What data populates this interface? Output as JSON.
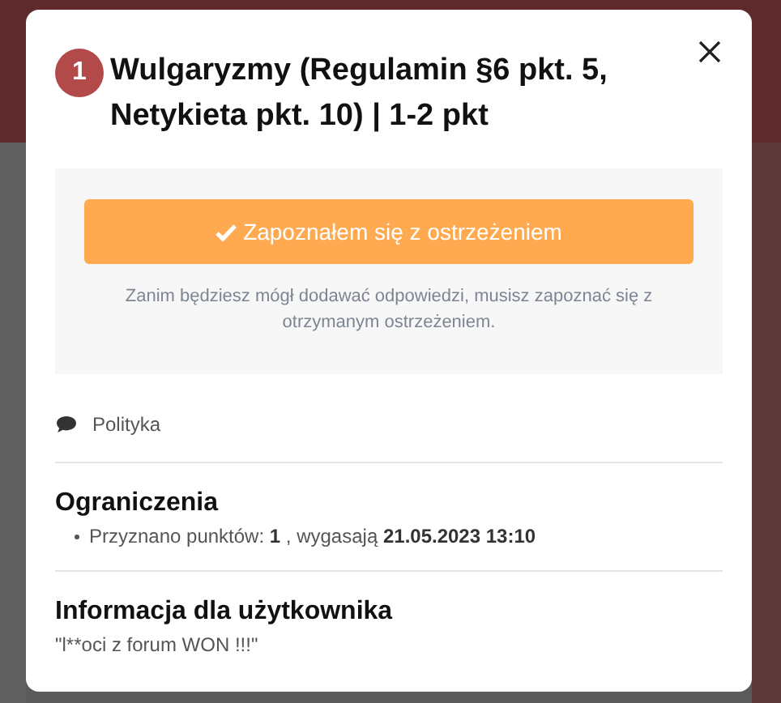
{
  "modal": {
    "badge": "1",
    "title": "Wulgaryzmy (Regulamin §6 pkt. 5, Netykieta pkt. 10) | 1-2 pkt",
    "acknowledge": {
      "button": "Zapoznałem się z ostrzeżeniem",
      "note": "Zanim będziesz mógł dodawać odpowiedzi, musisz zapoznać się z otrzymanym ostrzeżeniem."
    },
    "category": "Polityka",
    "sections": [
      {
        "heading": "Ograniczenia",
        "kind": "list",
        "items": [
          "Przyznano punktów: **1** , wygasają **21.05.2023 13:10**"
        ]
      },
      {
        "heading": "Informacja dla użytkownika",
        "kind": "text",
        "items": [
          "\"l**oci z forum WON !!!\""
        ]
      }
    ]
  }
}
